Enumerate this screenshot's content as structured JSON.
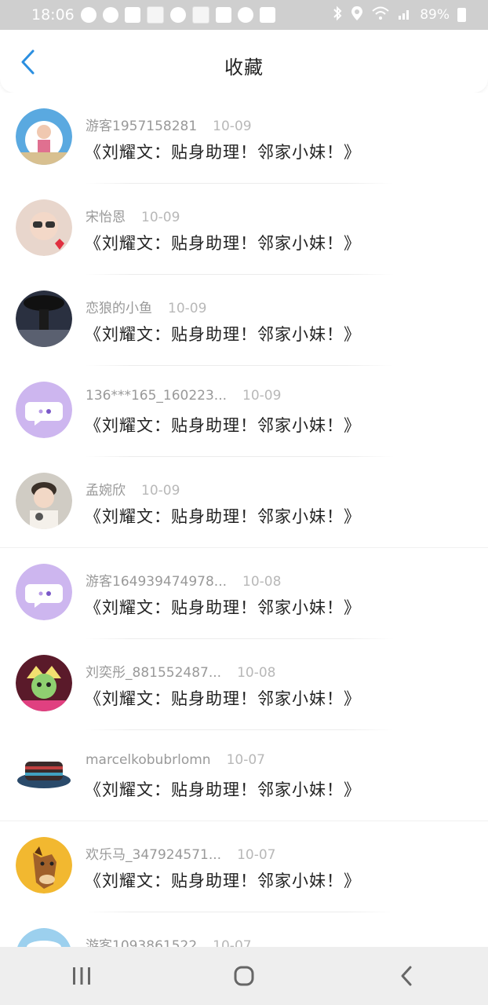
{
  "status_bar": {
    "time": "18:06",
    "battery": "89%"
  },
  "header": {
    "title": "收藏",
    "back_icon": "chevron-left-icon"
  },
  "colors": {
    "accent": "#2b8fe0",
    "meta_text": "#999999",
    "title_text": "#222222"
  },
  "items": [
    {
      "username": "游客1957158281",
      "date": "10-09",
      "title": "《刘耀文：贴身助理！邻家小妹！》",
      "avatar": "doraemon-girl"
    },
    {
      "username": "宋怡恩",
      "date": "10-09",
      "title": "《刘耀文：贴身助理！邻家小妹！》",
      "avatar": "girl-selfie"
    },
    {
      "username": "恋狼的小鱼",
      "date": "10-09",
      "title": "《刘耀文：贴身助理！邻家小妹！》",
      "avatar": "umbrella-figure"
    },
    {
      "username": "136***165_160223...",
      "date": "10-09",
      "title": "《刘耀文：贴身助理！邻家小妹！》",
      "avatar": "default-chat"
    },
    {
      "username": "孟婉欣",
      "date": "10-09",
      "title": "《刘耀文：贴身助理！邻家小妹！》",
      "avatar": "boy-photo"
    },
    {
      "username": "游客164939474978...",
      "date": "10-08",
      "title": "《刘耀文：贴身助理！邻家小妹！》",
      "avatar": "default-chat"
    },
    {
      "username": "刘奕彤_881552487...",
      "date": "10-08",
      "title": "《刘耀文：贴身助理！邻家小妹！》",
      "avatar": "cartoon-character"
    },
    {
      "username": "marcelkobubrlomn",
      "date": "10-07",
      "title": "《刘耀文：贴身助理！邻家小妹！》",
      "avatar": "hat"
    },
    {
      "username": "欢乐马_347924571...",
      "date": "10-07",
      "title": "《刘耀文：贴身助理！邻家小妹！》",
      "avatar": "horse-cartoon"
    },
    {
      "username": "游客1093861522",
      "date": "10-07",
      "title": "",
      "avatar": "sky-photo"
    }
  ],
  "nav": {
    "recents_icon": "recents-icon",
    "home_icon": "home-icon",
    "back_icon": "back-icon"
  }
}
